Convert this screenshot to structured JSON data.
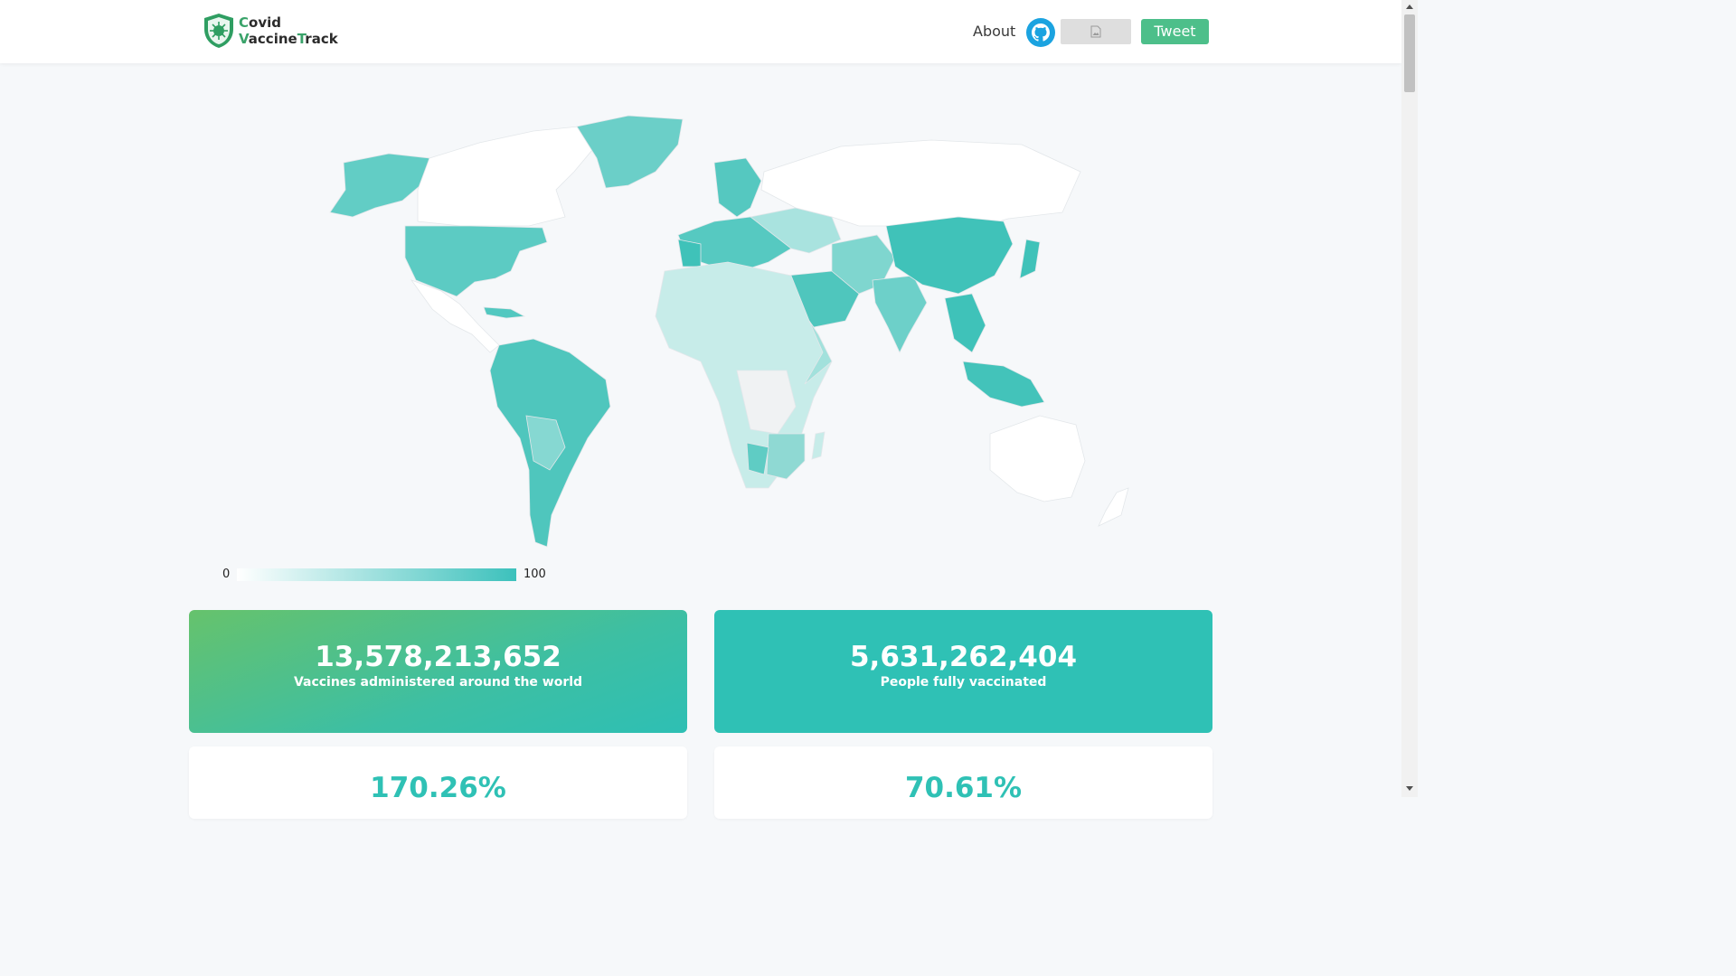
{
  "header": {
    "logo_line1_accent": "C",
    "logo_line1_rest": "ovid",
    "logo_line2_accent1": "V",
    "logo_line2_mid": "accine",
    "logo_line2_accent2": "T",
    "logo_line2_rest": "rack",
    "about_label": "About",
    "tweet_label": "Tweet",
    "icons": [
      "shield-virus-icon",
      "github-icon",
      "broken-image-icon"
    ]
  },
  "legend": {
    "min": "0",
    "max": "100",
    "color_low": "#ffffff",
    "color_high": "#3cc1bc"
  },
  "stats": [
    {
      "value": "13,578,213,652",
      "label": "Vaccines administered around the world"
    },
    {
      "value": "5,631,262,404",
      "label": "People fully vaccinated"
    },
    {
      "value": "170.26%"
    },
    {
      "value": "70.61%"
    }
  ],
  "colors": {
    "accent_green": "#4dbf8a",
    "accent_teal": "#2fc1b5",
    "gradient_start": "#66c26c"
  }
}
